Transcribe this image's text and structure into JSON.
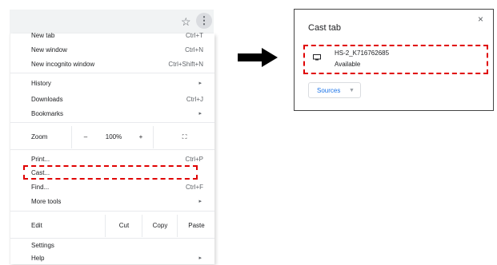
{
  "toolbar": {
    "star_icon": "star-icon",
    "menu_icon": "kebab-icon"
  },
  "menu": {
    "new_tab": {
      "label": "New tab",
      "shortcut": "Ctrl+T"
    },
    "new_window": {
      "label": "New window",
      "shortcut": "Ctrl+N"
    },
    "new_incognito": {
      "label": "New incognito window",
      "shortcut": "Ctrl+Shift+N"
    },
    "history": {
      "label": "History",
      "arrow": "▸"
    },
    "downloads": {
      "label": "Downloads",
      "shortcut": "Ctrl+J"
    },
    "bookmarks": {
      "label": "Bookmarks",
      "arrow": "▸"
    },
    "zoom": {
      "label": "Zoom",
      "minus": "–",
      "value": "100%",
      "plus": "+",
      "fullscreen": "⛶"
    },
    "print": {
      "label": "Print...",
      "shortcut": "Ctrl+P"
    },
    "cast": {
      "label": "Cast..."
    },
    "find": {
      "label": "Find...",
      "shortcut": "Ctrl+F"
    },
    "more_tools": {
      "label": "More tools",
      "arrow": "▸"
    },
    "edit": {
      "label": "Edit",
      "cut": "Cut",
      "copy": "Copy",
      "paste": "Paste"
    },
    "settings": {
      "label": "Settings"
    },
    "help": {
      "label": "Help",
      "arrow": "▸"
    }
  },
  "dialog": {
    "title": "Cast tab",
    "close": "×",
    "device": {
      "name": "HS-2_K716762685",
      "status": "Available"
    },
    "sources_label": "Sources",
    "sources_caret": "▼"
  },
  "colors": {
    "highlight": "#e00000",
    "link": "#1a73e8"
  }
}
